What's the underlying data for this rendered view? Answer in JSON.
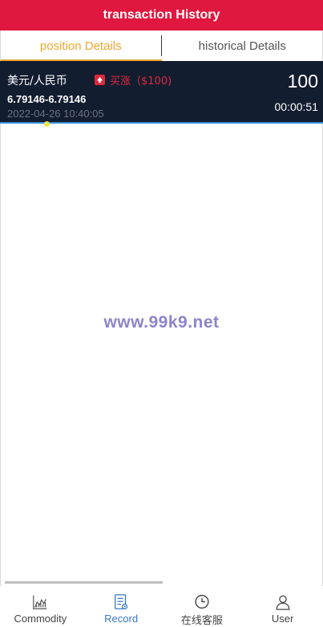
{
  "header": {
    "title": "transaction History"
  },
  "tabs": [
    {
      "label": "position Details",
      "active": true
    },
    {
      "label": "historical Details",
      "active": false
    }
  ],
  "position": {
    "pair": "美元/人民币",
    "direction_label": "买涨（$100)",
    "direction_icon": "arrow-up-icon",
    "price_range": "6.79146-6.79146",
    "timestamp": "2022-04-26 10:40:05",
    "amount": "100",
    "countdown": "00:00:51"
  },
  "watermark": {
    "text": "www.99k9.net"
  },
  "bottom_nav": [
    {
      "label": "Commodity",
      "icon": "chart-icon",
      "active": false
    },
    {
      "label": "Record",
      "icon": "document-icon",
      "active": true
    },
    {
      "label": "在线客服",
      "icon": "clock-icon",
      "active": false
    },
    {
      "label": "User",
      "icon": "user-icon",
      "active": false
    }
  ],
  "colors": {
    "header_bg": "#e0173e",
    "active_tab": "#f0a630",
    "card_bg": "#131d30",
    "direction_up": "#e0283c",
    "nav_active": "#3a78c8"
  }
}
